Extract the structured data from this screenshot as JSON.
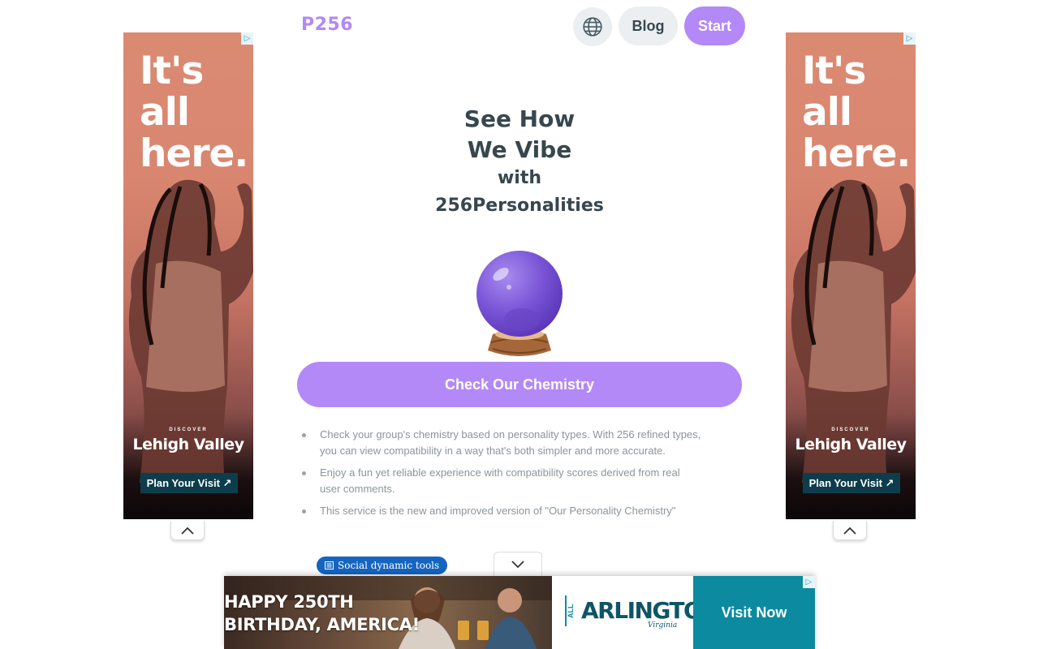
{
  "header": {
    "logo": "P256",
    "blog_label": "Blog",
    "start_label": "Start",
    "globe_icon": "globe-icon"
  },
  "hero": {
    "title_line1": "See How",
    "title_line2": "We Vibe",
    "title_line3": "with",
    "title_line4": "256Personalities",
    "illustration": "crystal-ball",
    "cta_label": "Check Our Chemistry"
  },
  "features": [
    "Check your group's chemistry based on personality types. With 256 refined types, you can view compatibility in a way that's both simpler and more accurate.",
    "Enjoy a fun yet reliable experience with compatibility scores derived from real user comments.",
    "This service is the new and improved version of \"Our Personality Chemistry\""
  ],
  "tag": {
    "label": "Social dynamic tools",
    "icon": "newspaper-icon"
  },
  "side_ad": {
    "headline": "It's\nall\nhere.",
    "discover": "DISCOVER",
    "brand": "Lehigh Valley",
    "cta": "Plan Your Visit ↗"
  },
  "bottom_ad": {
    "headline": "HAPPY 250TH\nBIRTHDAY, AMERICA!",
    "logo_prefix": "ALL",
    "logo": "ARLINGTON",
    "logo_sub": "Virginia",
    "cta": "Visit Now"
  },
  "colors": {
    "accent": "#b388f7",
    "text_dark": "#37474f",
    "text_muted": "#8a959b",
    "tag_blue": "#1565c0",
    "ad_teal": "#0b8aa0"
  }
}
